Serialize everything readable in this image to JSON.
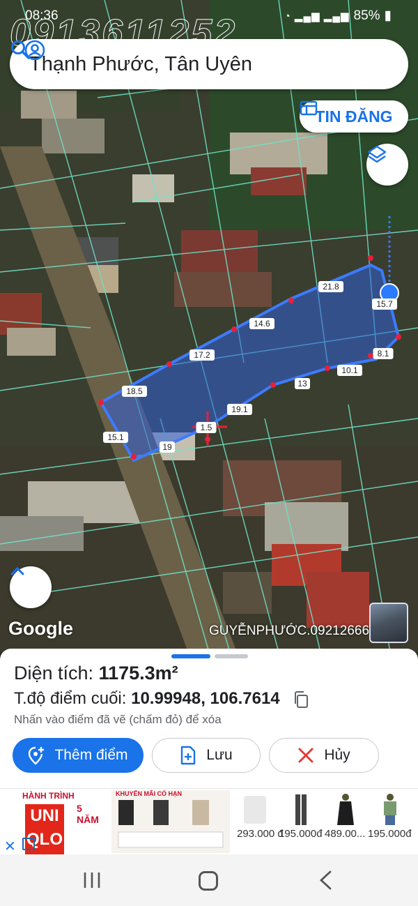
{
  "status_bar": {
    "time": "08:36",
    "battery": "85%",
    "icons": "wifi, signal, battery"
  },
  "watermark_phone": "0913611252",
  "search": {
    "query": "Thạnh Phước, Tân Uyên"
  },
  "map": {
    "tin_dang_label": "TIN ĐĂNG",
    "google_label": "Google",
    "credit_watermark": "GUYỄNPHƯỚC.09212666",
    "edge_lengths": [
      "21.8",
      "15.7",
      "8.1",
      "10.1",
      "13",
      "19.1",
      "1.5",
      "19",
      "15.1",
      "18.5",
      "17.2",
      "14.6"
    ],
    "colors": {
      "polygon_fill": "#2f5fd8",
      "polygon_stroke": "#3d7bff",
      "parcel_lines": "#6fe3c9",
      "vertex": "#e8203a"
    }
  },
  "sheet": {
    "area_label": "Diện tích:",
    "area_value": "1175.3m²",
    "coord_label": "T.độ điểm cuối:",
    "coord_value": "10.99948, 106.7614",
    "hint": "Nhấn vào điểm đã vẽ (chấm đỏ) để xóa",
    "add_point": "Thêm điểm",
    "save": "Lưu",
    "cancel": "Hủy"
  },
  "ad": {
    "logo_text": "UNI QLO",
    "side_text": "5 NĂM",
    "banner_title": "HÀNH TRÌNH",
    "promo_title": "KHUYẾN MÃI CÓ HẠN",
    "prices": [
      "293.000 đ",
      "195.000đ",
      "489.00...",
      "195.000đ"
    ]
  }
}
